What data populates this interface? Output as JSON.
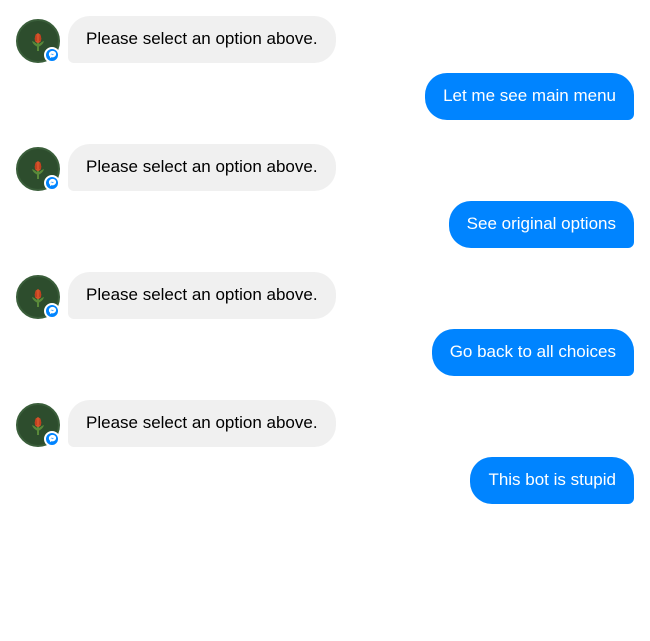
{
  "messages": [
    {
      "id": "bot1",
      "type": "bot",
      "text": "Please select an option above."
    },
    {
      "id": "user1",
      "type": "user",
      "text": "Let me see main menu"
    },
    {
      "id": "bot2",
      "type": "bot",
      "text": "Please select an option above."
    },
    {
      "id": "user2",
      "type": "user",
      "text": "See original options"
    },
    {
      "id": "bot3",
      "type": "bot",
      "text": "Please select an option above."
    },
    {
      "id": "user3",
      "type": "user",
      "text": "Go back to all choices"
    },
    {
      "id": "bot4",
      "type": "bot",
      "text": "Please select an option above."
    },
    {
      "id": "user4",
      "type": "user",
      "text": "This bot is stupid"
    }
  ],
  "colors": {
    "userBubble": "#0084ff",
    "botBubble": "#f0f0f0",
    "messengerBlue": "#0084ff"
  }
}
